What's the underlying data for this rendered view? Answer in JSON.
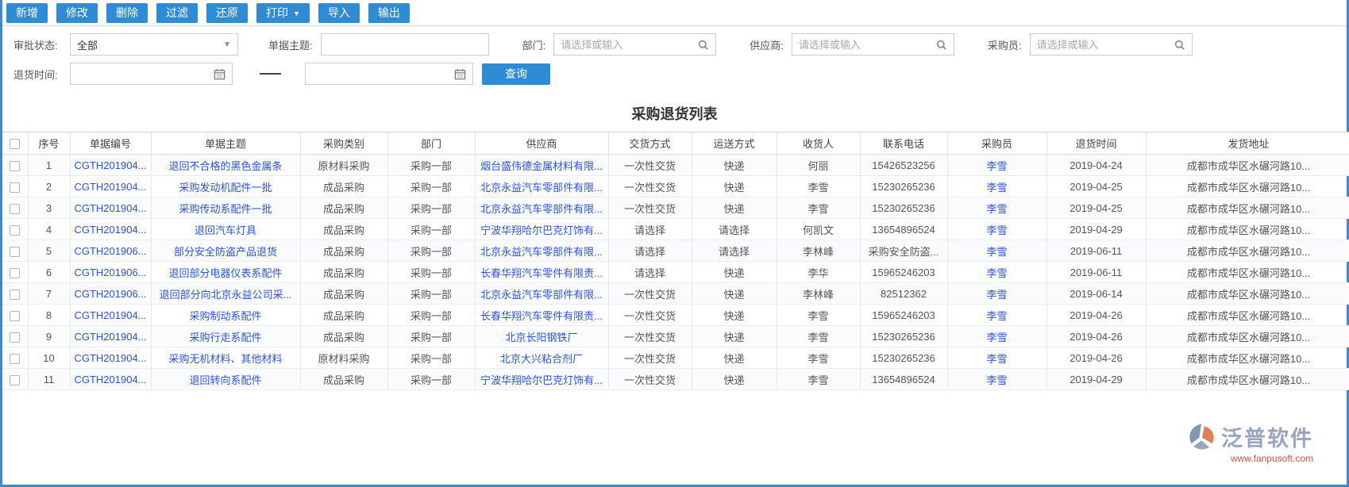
{
  "toolbar": {
    "buttons": [
      {
        "label": "新增",
        "has_dropdown": false
      },
      {
        "label": "修改",
        "has_dropdown": false
      },
      {
        "label": "删除",
        "has_dropdown": false
      },
      {
        "label": "过滤",
        "has_dropdown": false
      },
      {
        "label": "还原",
        "has_dropdown": false
      },
      {
        "label": "打印",
        "has_dropdown": true
      },
      {
        "label": "导入",
        "has_dropdown": false
      },
      {
        "label": "输出",
        "has_dropdown": false
      }
    ]
  },
  "filters": {
    "approval_status": {
      "label": "审批状态:",
      "value": "全部"
    },
    "doc_subject": {
      "label": "单据主题:",
      "value": ""
    },
    "department": {
      "label": "部门:",
      "placeholder": "请选择或输入"
    },
    "supplier": {
      "label": "供应商:",
      "placeholder": "请选择或输入"
    },
    "purchaser": {
      "label": "采购员:",
      "placeholder": "请选择或输入"
    },
    "return_time": {
      "label": "退货时间:",
      "from": "",
      "to": ""
    },
    "search_button": "查询"
  },
  "table": {
    "title": "采购退货列表",
    "columns": [
      "序号",
      "单据编号",
      "单据主题",
      "采购类别",
      "部门",
      "供应商",
      "交货方式",
      "运送方式",
      "收货人",
      "联系电话",
      "采购员",
      "退货时间",
      "发货地址"
    ],
    "rows": [
      {
        "seq": "1",
        "doc_no": "CGTH201904...",
        "subject": "退回不合格的黑色金属条",
        "category": "原材料采购",
        "department": "采购一部",
        "supplier": "烟台盛伟德金属材料有限...",
        "delivery": "一次性交货",
        "shipping": "快递",
        "receiver": "何丽",
        "phone": "15426523256",
        "purchaser": "李雪",
        "return_date": "2019-04-24",
        "address": "成都市成华区水碾河路10..."
      },
      {
        "seq": "2",
        "doc_no": "CGTH201904...",
        "subject": "采购发动机配件一批",
        "category": "成品采购",
        "department": "采购一部",
        "supplier": "北京永益汽车零部件有限...",
        "delivery": "一次性交货",
        "shipping": "快递",
        "receiver": "李雪",
        "phone": "15230265236",
        "purchaser": "李雪",
        "return_date": "2019-04-25",
        "address": "成都市成华区水碾河路10..."
      },
      {
        "seq": "3",
        "doc_no": "CGTH201904...",
        "subject": "采购传动系配件一批",
        "category": "成品采购",
        "department": "采购一部",
        "supplier": "北京永益汽车零部件有限...",
        "delivery": "一次性交货",
        "shipping": "快递",
        "receiver": "李雪",
        "phone": "15230265236",
        "purchaser": "李雪",
        "return_date": "2019-04-25",
        "address": "成都市成华区水碾河路10..."
      },
      {
        "seq": "4",
        "doc_no": "CGTH201904...",
        "subject": "退回汽车灯具",
        "category": "成品采购",
        "department": "采购一部",
        "supplier": "宁波华翔哈尔巴克灯饰有...",
        "delivery": "请选择",
        "shipping": "请选择",
        "receiver": "何凯文",
        "phone": "13654896524",
        "purchaser": "李雪",
        "return_date": "2019-04-29",
        "address": "成都市成华区水碾河路10..."
      },
      {
        "seq": "5",
        "doc_no": "CGTH201906...",
        "subject": "部分安全防盗产品退货",
        "category": "成品采购",
        "department": "采购一部",
        "supplier": "北京永益汽车零部件有限...",
        "delivery": "请选择",
        "shipping": "请选择",
        "receiver": "李林峰",
        "phone": "采购安全防盗...",
        "purchaser": "李雪",
        "return_date": "2019-06-11",
        "address": "成都市成华区水碾河路10..."
      },
      {
        "seq": "6",
        "doc_no": "CGTH201906...",
        "subject": "退回部分电器仪表系配件",
        "category": "成品采购",
        "department": "采购一部",
        "supplier": "长春华翔汽车零件有限责...",
        "delivery": "请选择",
        "shipping": "快递",
        "receiver": "李华",
        "phone": "15965246203",
        "purchaser": "李雪",
        "return_date": "2019-06-11",
        "address": "成都市成华区水碾河路10..."
      },
      {
        "seq": "7",
        "doc_no": "CGTH201906...",
        "subject": "退回部分向北京永益公司采...",
        "category": "成品采购",
        "department": "采购一部",
        "supplier": "北京永益汽车零部件有限...",
        "delivery": "一次性交货",
        "shipping": "快递",
        "receiver": "李林峰",
        "phone": "82512362",
        "purchaser": "李雪",
        "return_date": "2019-06-14",
        "address": "成都市成华区水碾河路10..."
      },
      {
        "seq": "8",
        "doc_no": "CGTH201904...",
        "subject": "采购制动系配件",
        "category": "成品采购",
        "department": "采购一部",
        "supplier": "长春华翔汽车零件有限责...",
        "delivery": "一次性交货",
        "shipping": "快递",
        "receiver": "李雪",
        "phone": "15965246203",
        "purchaser": "李雪",
        "return_date": "2019-04-26",
        "address": "成都市成华区水碾河路10..."
      },
      {
        "seq": "9",
        "doc_no": "CGTH201904...",
        "subject": "采购行走系配件",
        "category": "成品采购",
        "department": "采购一部",
        "supplier": "北京长阳钢铁厂",
        "delivery": "一次性交货",
        "shipping": "快递",
        "receiver": "李雪",
        "phone": "15230265236",
        "purchaser": "李雪",
        "return_date": "2019-04-26",
        "address": "成都市成华区水碾河路10..."
      },
      {
        "seq": "10",
        "doc_no": "CGTH201904...",
        "subject": "采购无机材料、其他材料",
        "category": "原材料采购",
        "department": "采购一部",
        "supplier": "北京大兴粘合剂厂",
        "delivery": "一次性交货",
        "shipping": "快递",
        "receiver": "李雪",
        "phone": "15230265236",
        "purchaser": "李雪",
        "return_date": "2019-04-26",
        "address": "成都市成华区水碾河路10..."
      },
      {
        "seq": "11",
        "doc_no": "CGTH201904...",
        "subject": "退回转向系配件",
        "category": "成品采购",
        "department": "采购一部",
        "supplier": "宁波华翔哈尔巴克灯饰有...",
        "delivery": "一次性交货",
        "shipping": "快递",
        "receiver": "李雪",
        "phone": "13654896524",
        "purchaser": "李雪",
        "return_date": "2019-04-29",
        "address": "成都市成华区水碾河路10..."
      }
    ]
  },
  "watermark": {
    "brand": "泛普软件",
    "url": "www.fanpusoft.com"
  },
  "colors": {
    "accent": "#2e8bd4",
    "link": "#2b55d5",
    "frame_border": "#4388c3",
    "watermark_brand": "#97a6c0",
    "watermark_url": "#cb5442"
  }
}
